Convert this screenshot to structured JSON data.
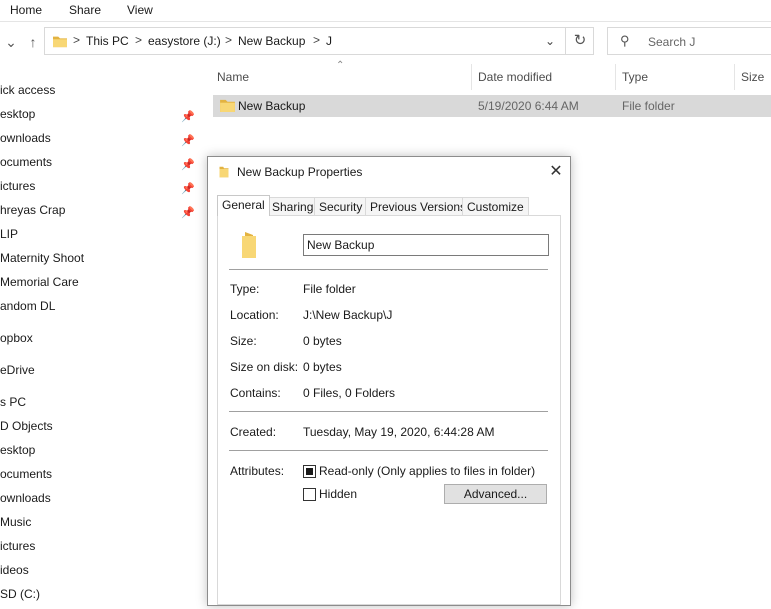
{
  "ribbon": {
    "tabs": [
      "Home",
      "Share",
      "View"
    ]
  },
  "address_bar": {
    "crumbs": [
      "This PC",
      "easystore (J:)",
      "New Backup",
      "J"
    ],
    "separator": ">"
  },
  "search": {
    "placeholder": "Search J"
  },
  "sidebar": {
    "items": [
      {
        "label": "ick access",
        "pinned": false
      },
      {
        "label": "esktop",
        "pinned": true
      },
      {
        "label": "ownloads",
        "pinned": true
      },
      {
        "label": "ocuments",
        "pinned": true
      },
      {
        "label": "ictures",
        "pinned": true
      },
      {
        "label": "hreyas Crap",
        "pinned": true
      },
      {
        "label": "LIP",
        "pinned": false
      },
      {
        "label": "Maternity Shoot",
        "pinned": false
      },
      {
        "label": "Memorial Care",
        "pinned": false
      },
      {
        "label": "andom DL",
        "pinned": false
      },
      {
        "label": "opbox",
        "pinned": false
      },
      {
        "label": "eDrive",
        "pinned": false
      },
      {
        "label": "s PC",
        "pinned": false
      },
      {
        "label": "D Objects",
        "pinned": false
      },
      {
        "label": "esktop",
        "pinned": false
      },
      {
        "label": "ocuments",
        "pinned": false
      },
      {
        "label": "ownloads",
        "pinned": false
      },
      {
        "label": "Music",
        "pinned": false
      },
      {
        "label": "ictures",
        "pinned": false
      },
      {
        "label": "ideos",
        "pinned": false
      },
      {
        "label": "SD (C:)",
        "pinned": false
      }
    ]
  },
  "file_list": {
    "columns": [
      "Name",
      "Date modified",
      "Type",
      "Size"
    ],
    "rows": [
      {
        "name": "New Backup",
        "date_modified": "5/19/2020 6:44 AM",
        "type": "File folder",
        "size": ""
      }
    ]
  },
  "dialog": {
    "title": "New Backup Properties",
    "tabs": [
      "General",
      "Sharing",
      "Security",
      "Previous Versions",
      "Customize"
    ],
    "active_tab": "General",
    "name_value": "New Backup",
    "props": {
      "type": {
        "label": "Type:",
        "value": "File folder"
      },
      "location": {
        "label": "Location:",
        "value": "J:\\New Backup\\J"
      },
      "size": {
        "label": "Size:",
        "value": "0 bytes"
      },
      "size_on_disk": {
        "label": "Size on disk:",
        "value": "0 bytes"
      },
      "contains": {
        "label": "Contains:",
        "value": "0 Files, 0 Folders"
      },
      "created": {
        "label": "Created:",
        "value": "Tuesday, May 19, 2020, 6:44:28 AM"
      },
      "attributes": {
        "label": "Attributes:"
      }
    },
    "attributes": {
      "readonly_label": "Read-only (Only applies to files in folder)",
      "readonly_state": "indeterminate",
      "hidden_label": "Hidden",
      "hidden_checked": false,
      "advanced_label": "Advanced..."
    }
  },
  "colors": {
    "folder_yellow": "#f8d775",
    "folder_dark": "#e3b341",
    "selection": "#d9d9d9"
  }
}
